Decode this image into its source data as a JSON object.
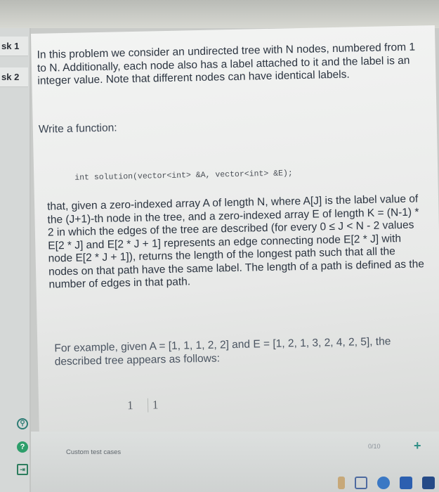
{
  "sidebar": {
    "tabs": [
      {
        "label": "sk 1"
      },
      {
        "label": "sk 2"
      }
    ],
    "icons": [
      "search-icon",
      "help-icon",
      "login-icon"
    ]
  },
  "problem": {
    "intro": "In this problem we consider an undirected tree with N nodes, numbered from 1 to N. Additionally, each node also has a label attached to it and the label is an integer value. Note that different nodes can have identical labels.",
    "write_function": "Write a function:",
    "signature": "int solution(vector<int> &A, vector<int> &E);",
    "description": "that, given a zero-indexed array A of length N, where A[J] is the label value of the (J+1)-th node in the tree, and a zero-indexed array E of length K = (N-1) * 2 in which the edges of the tree are described (for every 0 ≤ J < N - 2 values E[2 * J] and E[2 * J + 1] represents an edge connecting node E[2 * J] with node E[2 * J + 1]), returns the length of the longest path such that all the nodes on that path have the same label. The length of a path is defined as the number of edges in that path.",
    "example": "For example, given A = [1, 1, 1, 2, 2] and E = [1, 2, 1, 3, 2, 4, 2, 5], the described tree appears as follows:",
    "tree_nodes": [
      "1",
      "1"
    ]
  },
  "footer": {
    "custom_tests": "Custom test cases",
    "counter": "0/10",
    "add": "+"
  }
}
